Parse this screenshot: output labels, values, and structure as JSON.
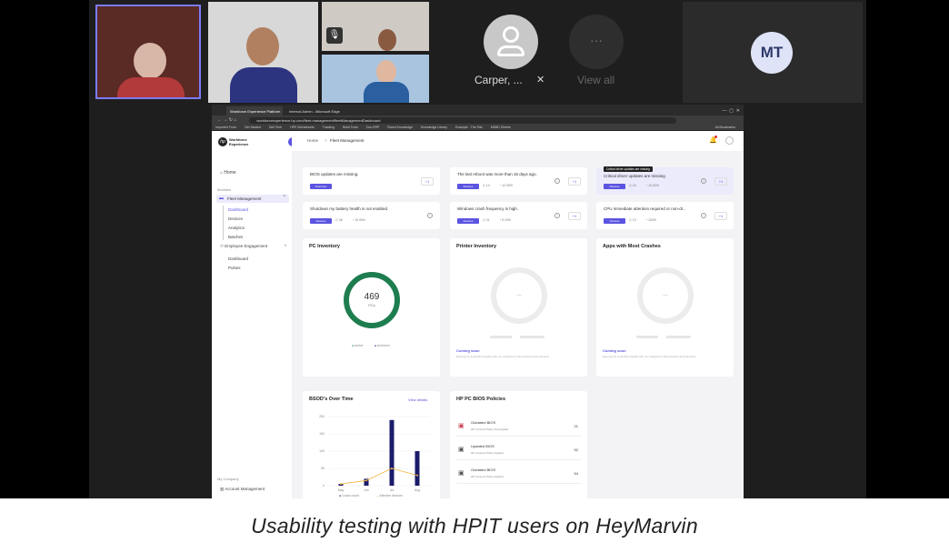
{
  "participants": {
    "tile_name": "Carper, ...",
    "view_all_label": "View all",
    "initials": "MT"
  },
  "browser": {
    "tabs": [
      "Workforce Experience Platform",
      "Internal Admin - Microsoft Edge"
    ],
    "url": "workforceexperience.hp.com/fleet-management/fleetManagementDashboard",
    "bookmarks": [
      "Imported From",
      "Get Started",
      "Dell Tech",
      "HPE Worksheets",
      "Tracking",
      "Build Tools",
      "Doc ERP",
      "Brand Knowledge",
      "Knowledge Library",
      "Example - The Site",
      "MSBD Sheets",
      "All Bookmarks"
    ]
  },
  "app": {
    "brand": "Workforce Experience",
    "breadcrumb": {
      "home": "Home",
      "separator": ">",
      "current": "Fleet Management"
    },
    "nav": {
      "home": "Home",
      "section": "Modules",
      "fleet": "Fleet Management",
      "fleet_items": [
        "Dashboard",
        "Devices",
        "Analytics",
        "Batches"
      ],
      "employee": "Employee Engagement",
      "employee_items": [
        "Dashboard",
        "Pulses"
      ],
      "company_section": "My Company",
      "account": "Account Management"
    },
    "alerts": [
      {
        "text": "BIOS updates are missing.",
        "button": "Overview",
        "meta1": "",
        "meta2": "",
        "plus": "+1"
      },
      {
        "text": "The last reboot was more than 15 days ago.",
        "button": "Devices",
        "meta1": "14",
        "meta2": "12.30%",
        "plus": "+1"
      },
      {
        "text": "Critical driver updates are missing",
        "button": "Devices",
        "meta1": "44",
        "meta2": "10.00%",
        "plus": "+1",
        "tooltip": "Critical driver updates are missing"
      },
      {
        "text": "Shutdown my battery health is not enabled.",
        "button": "Devices",
        "meta1": "46",
        "meta2": "10.90%",
        "plus": "+1"
      },
      {
        "text": "Windows crash frequency is high.",
        "button": "Devices",
        "meta1": "21",
        "meta2": "9.19%",
        "plus": "+1"
      },
      {
        "text": "CPU immediate attention required or non-dr...",
        "button": "Devices",
        "meta1": "13",
        "meta2": "100%",
        "plus": "+1"
      }
    ],
    "pc_inventory": {
      "title": "PC Inventory",
      "total": "469",
      "unit": "PCs",
      "legend": [
        "Active",
        "Archived"
      ]
    },
    "printer_inventory": {
      "title": "Printer Inventory",
      "placeholder": "—",
      "coming_soon": "Coming soon",
      "desc": "Experience impactful insights with our analytics of their devices and solutions"
    },
    "apps_crashes": {
      "title": "Apps with Most Crashes",
      "placeholder": "—",
      "coming_soon": "Coming soon",
      "desc": "Experience impactful insights with our analytics of their devices and solutions"
    },
    "bsod": {
      "title": "BSOD's Over Time",
      "link": "View details",
      "legend": [
        "Crash count",
        "Affected devices"
      ]
    },
    "bios_policies": {
      "title": "HP PC BIOS Policies",
      "rows": [
        {
          "label": "Outdated BIOS",
          "sub": "HP Connect Policy Not Applied",
          "value": "21"
        },
        {
          "label": "Updated BIOS",
          "sub": "HP Connect Policy Applied",
          "value": "52"
        },
        {
          "label": "Outdated BIOS",
          "sub": "HP Connect Policy Applied",
          "value": "54"
        }
      ]
    }
  },
  "chart_data": {
    "type": "bar",
    "title": "BSOD's Over Time",
    "categories": [
      "May",
      "Jun",
      "Jul",
      "Aug"
    ],
    "ylim": [
      0,
      200
    ],
    "yticks": [
      "200",
      "150",
      "100",
      "50",
      "0"
    ],
    "series": [
      {
        "name": "Crash count",
        "values": [
          5,
          20,
          190,
          100
        ]
      },
      {
        "name": "Affected devices",
        "values": [
          5,
          15,
          50,
          30
        ]
      }
    ]
  },
  "caption": "Usability testing with HPIT users on HeyMarvin",
  "colors": {
    "accent": "#5b54e0",
    "green": "#1e7d4f",
    "navy": "#1b1b6b",
    "amber": "#f2b33d"
  }
}
